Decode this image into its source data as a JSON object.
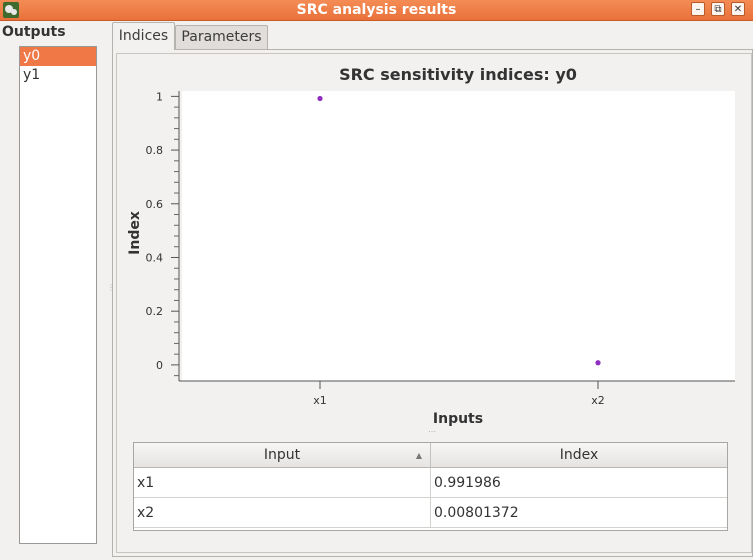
{
  "window": {
    "title": "SRC analysis results"
  },
  "outputs": {
    "label": "Outputs",
    "items": [
      "y0",
      "y1"
    ],
    "selected": "y0"
  },
  "tabs": [
    "Indices",
    "Parameters"
  ],
  "active_tab": "Indices",
  "chart_data": {
    "type": "scatter",
    "title": "SRC sensitivity indices: y0",
    "xlabel": "Inputs",
    "ylabel": "Index",
    "categories": [
      "x1",
      "x2"
    ],
    "values": [
      0.991986,
      0.00801372
    ],
    "ylim": [
      -0.06,
      1.02
    ],
    "yticks": [
      0,
      0.2,
      0.4,
      0.6,
      0.8,
      1
    ],
    "ytick_labels": [
      "0",
      "0.2",
      "0.4",
      "0.6",
      "0.8",
      "1"
    ],
    "point_color": "#8e2fc0",
    "grid": false
  },
  "table": {
    "headers": [
      "Input",
      "Index"
    ],
    "rows": [
      [
        "x1",
        "0.991986"
      ],
      [
        "x2",
        "0.00801372"
      ]
    ]
  }
}
